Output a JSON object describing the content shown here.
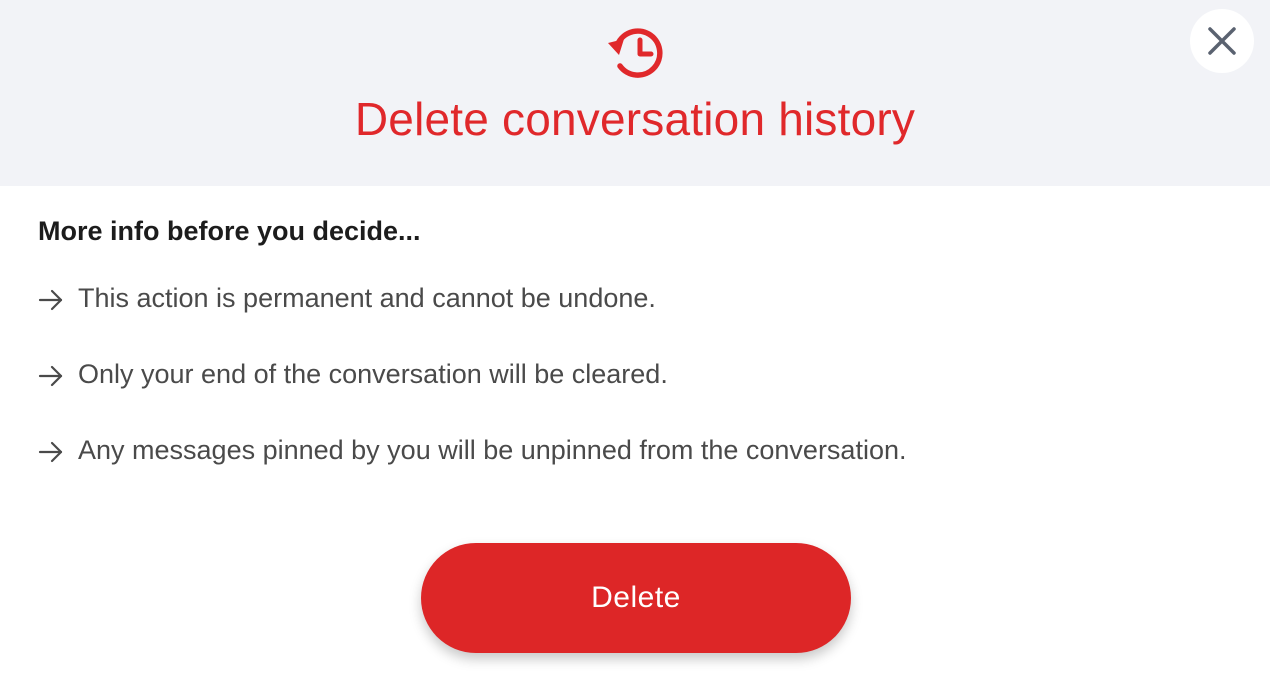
{
  "dialog": {
    "header_icon": "history-icon",
    "title": "Delete conversation history",
    "close_icon": "close-icon",
    "subheading": "More info before you decide...",
    "info_items": [
      {
        "icon": "arrow-right-icon",
        "text": "This action is permanent and cannot be undone."
      },
      {
        "icon": "arrow-right-icon",
        "text": "Only your end of the conversation will be cleared."
      },
      {
        "icon": "arrow-right-icon",
        "text": "Any messages pinned by you will be unpinned from the conversation."
      }
    ],
    "delete_label": "Delete"
  },
  "colors": {
    "accent": "#e0282b",
    "button_bg": "#dd2627",
    "header_bg": "#f2f3f7",
    "heading_text": "#1c1c1c",
    "body_text": "#4a4a4a",
    "close_icon": "#5a6270"
  }
}
